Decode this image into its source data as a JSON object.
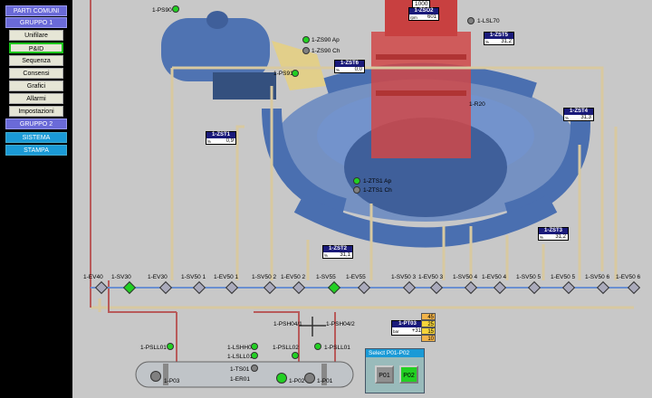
{
  "sidebar": {
    "items": [
      {
        "label": "PARTI COMUNI"
      },
      {
        "label": "GRUPPO 1"
      },
      {
        "label": "Unifilare"
      },
      {
        "label": "P&ID"
      },
      {
        "label": "Sequenza"
      },
      {
        "label": "Consensi"
      },
      {
        "label": "Grafici"
      },
      {
        "label": "Allarmi"
      },
      {
        "label": "Impostazioni"
      },
      {
        "label": "GRUPPO 2"
      },
      {
        "label": "SISTEMA"
      },
      {
        "label": "STAMPA"
      }
    ]
  },
  "zboxes": [
    {
      "tag": "1-ZSO2",
      "unit": "rpm",
      "value": "601"
    },
    {
      "tag": "1-ZST5",
      "unit": "%",
      "value": "31,2"
    },
    {
      "tag": "1-ZST6",
      "unit": "%",
      "value": "0,0"
    },
    {
      "tag": "1-ZST4",
      "unit": "%",
      "value": "31,3"
    },
    {
      "tag": "1-ZST1",
      "unit": "%",
      "value": "0,9"
    },
    {
      "tag": "1-ZST2",
      "unit": "%",
      "value": "31,1"
    },
    {
      "tag": "1-ZST3",
      "unit": "%",
      "value": "31,2"
    }
  ],
  "top_value": "1000",
  "labels": {
    "ps90": "1-PS90",
    "zs90ap": "1-ZS90 Ap",
    "zs90ch": "1-ZS90 Ch",
    "ps91": "1-PS91",
    "lsl70": "1-LSL70",
    "r20": "1-R20",
    "zts1ap": "1-ZTS1 Ap",
    "zts1ch": "1-ZTS1 Ch",
    "psh04_1": "1-PSH04/1",
    "psh04_2": "1-PSH04/2",
    "psll01a": "1-PSLL01",
    "lshh01": "1-LSHH01",
    "lsll01": "1-LSLL01",
    "psll02": "1-PSLL02",
    "psll01b": "1-PSLL01",
    "ts01": "1-TS01",
    "er01": "1-ER01",
    "p03": "1-P03",
    "p02": "1-P02",
    "p01": "1-P01"
  },
  "valves": [
    "1-EV40",
    "1-SV30",
    "1-EV30",
    "1-SV50 1",
    "1-EV50 1",
    "1-SV50 2",
    "1-EV50 2",
    "1-SV55",
    "1-EV55",
    "1-SV50 3",
    "1-EV50 3",
    "1-SV50 4",
    "1-EV50 4",
    "1-SV50 5",
    "1-EV50 5",
    "1-SV50 6",
    "1-EV50 6"
  ],
  "pt03": {
    "tag": "1-PT03",
    "unit": "bar",
    "value": "+31"
  },
  "pressure_bars": [
    "45",
    "25",
    "15",
    "10"
  ],
  "select_panel": {
    "title": "Select P01-P02",
    "p01": "P01",
    "p02": "P02"
  },
  "colors": {
    "sidebar_bg": "#000000",
    "header_blue": "#6a6ad8",
    "accent_cyan": "#1a9ad6",
    "status_green": "#22d022",
    "turbine_blue": "#4a74b8",
    "generator_red": "#d04848"
  }
}
